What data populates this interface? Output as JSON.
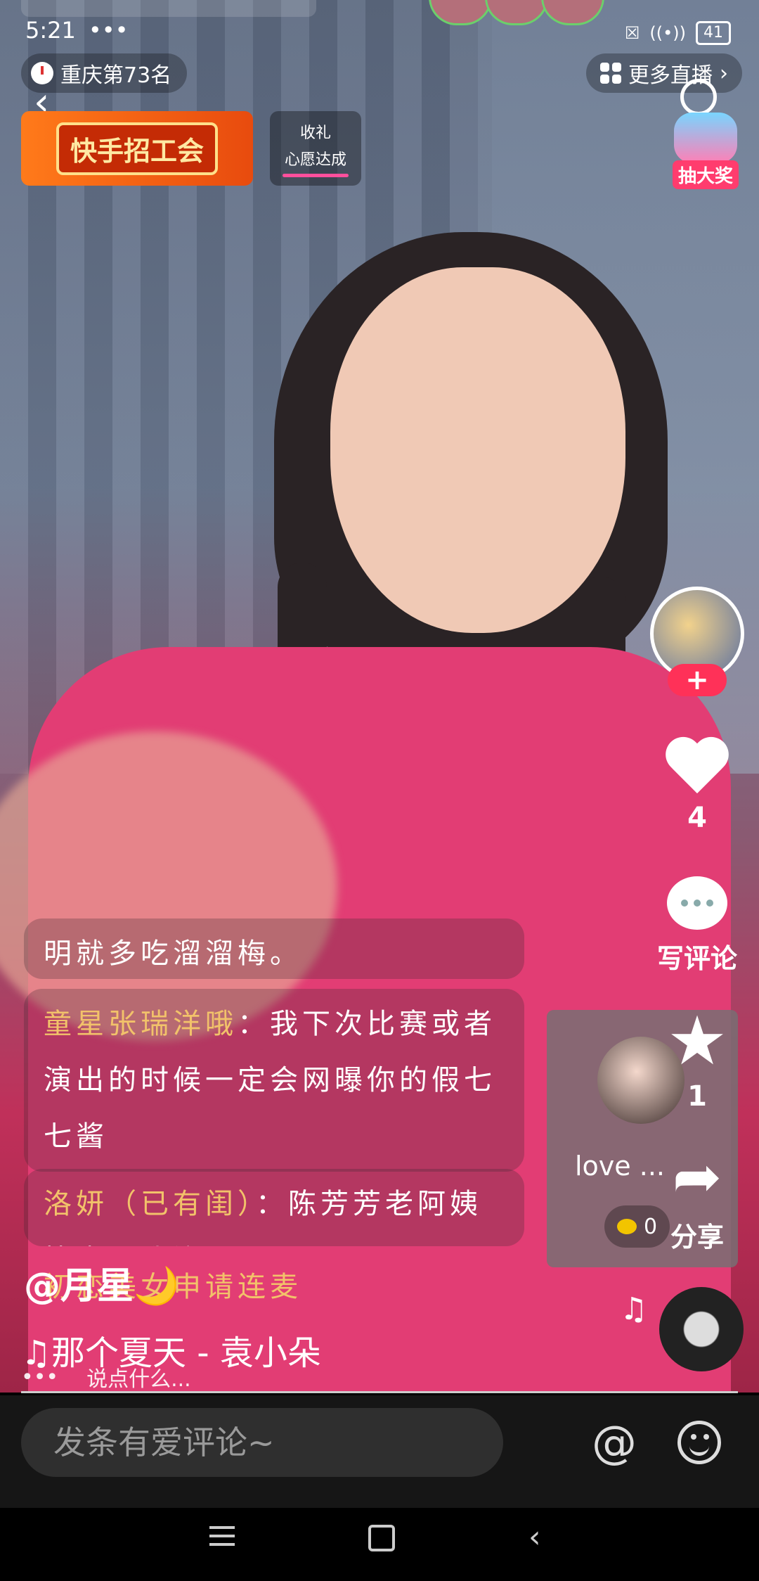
{
  "status_bar": {
    "time": "5:21",
    "dots": "•••",
    "battery": "41"
  },
  "top": {
    "rank_label": "重庆第73名",
    "more_live_label": "更多直播",
    "banner_text": "快手招工会",
    "gift_box": {
      "line1": "收礼",
      "line2": "心愿达成"
    },
    "lottery_label": "抽大奖"
  },
  "side": {
    "follow_plus": "+",
    "like_count": "4",
    "comment_label": "写评论",
    "star_count": "1",
    "share_label": "分享"
  },
  "pip": {
    "name": "love ...",
    "coins": "0"
  },
  "chat": [
    {
      "nick": "",
      "text": "明就多吃溜溜梅。"
    },
    {
      "nick": "童星张瑞洋哦",
      "text": "：我下次比赛或者演出的时候一定会网曝你的假七七酱"
    },
    {
      "nick": "洛妍（已有闺）",
      "text": "：陈芳芳老阿姨快点跟我连吧"
    },
    {
      "nick": "",
      "text": "初恋美女申请连麦"
    }
  ],
  "anchor": {
    "name": "@月星🌙"
  },
  "song": {
    "title": "♫那个夏天 - 袁小朵"
  },
  "bottom_bar": {
    "more": "•••",
    "say": "说点什么..."
  },
  "composer": {
    "placeholder": "发条有爱评论~",
    "at": "@"
  },
  "colors": {
    "accent": "#ff3158",
    "nick": "#f2c26a",
    "shirt": "#e23d74"
  }
}
